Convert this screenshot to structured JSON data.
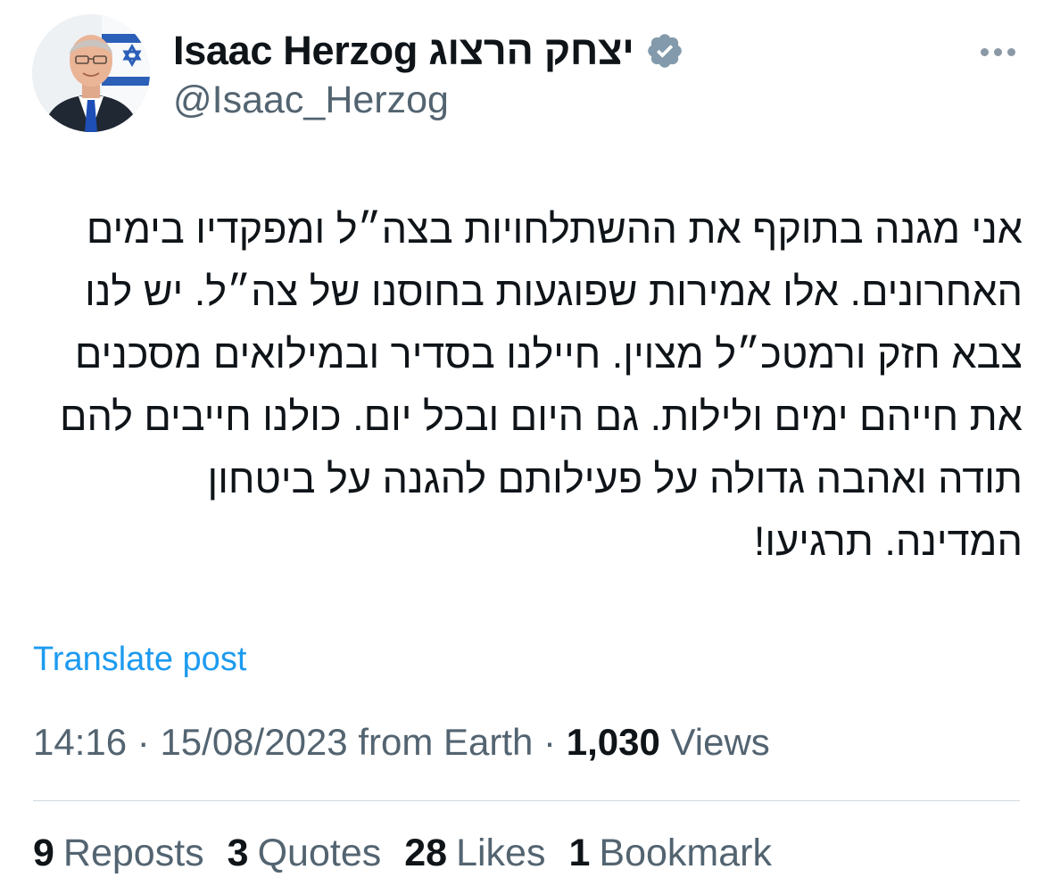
{
  "author": {
    "display_name": "Isaac Herzog יצחק הרצוג",
    "handle": "@Isaac_Herzog",
    "verified": true,
    "verified_color": "#829aab",
    "avatar": "profile-photo"
  },
  "post": {
    "lines": [
      "אני מגנה בתוקף את ההשתלחויות בצה״ל ומפקדיו בימים",
      "האחרונים. אלו אמירות שפוגעות בחוסנו של צה״ל. יש לנו",
      "צבא חזק ורמטכ״ל מצוין. חיילנו בסדיר ובמילואים מסכנים",
      "את חייהם ימים ולילות. גם היום ובכל יום. כולנו חייבים להם",
      "תודה ואהבה גדולה על פעילותם להגנה על ביטחון",
      "המדינה. תרגיעו!"
    ],
    "translate_label": "Translate post"
  },
  "meta": {
    "time": "14:16",
    "sep": " · ",
    "date": "15/08/2023",
    "source": " from Earth",
    "views_count": "1,030",
    "views_label": "Views"
  },
  "stats": {
    "reposts_count": "9",
    "reposts_label": "Reposts",
    "quotes_count": "3",
    "quotes_label": "Quotes",
    "likes_count": "28",
    "likes_label": "Likes",
    "bookmarks_count": "1",
    "bookmarks_label": "Bookmark"
  },
  "colors": {
    "link": "#1d9bf0",
    "secondary_text": "#536471",
    "primary_text": "#0f1419",
    "divider": "#cfd9de"
  }
}
